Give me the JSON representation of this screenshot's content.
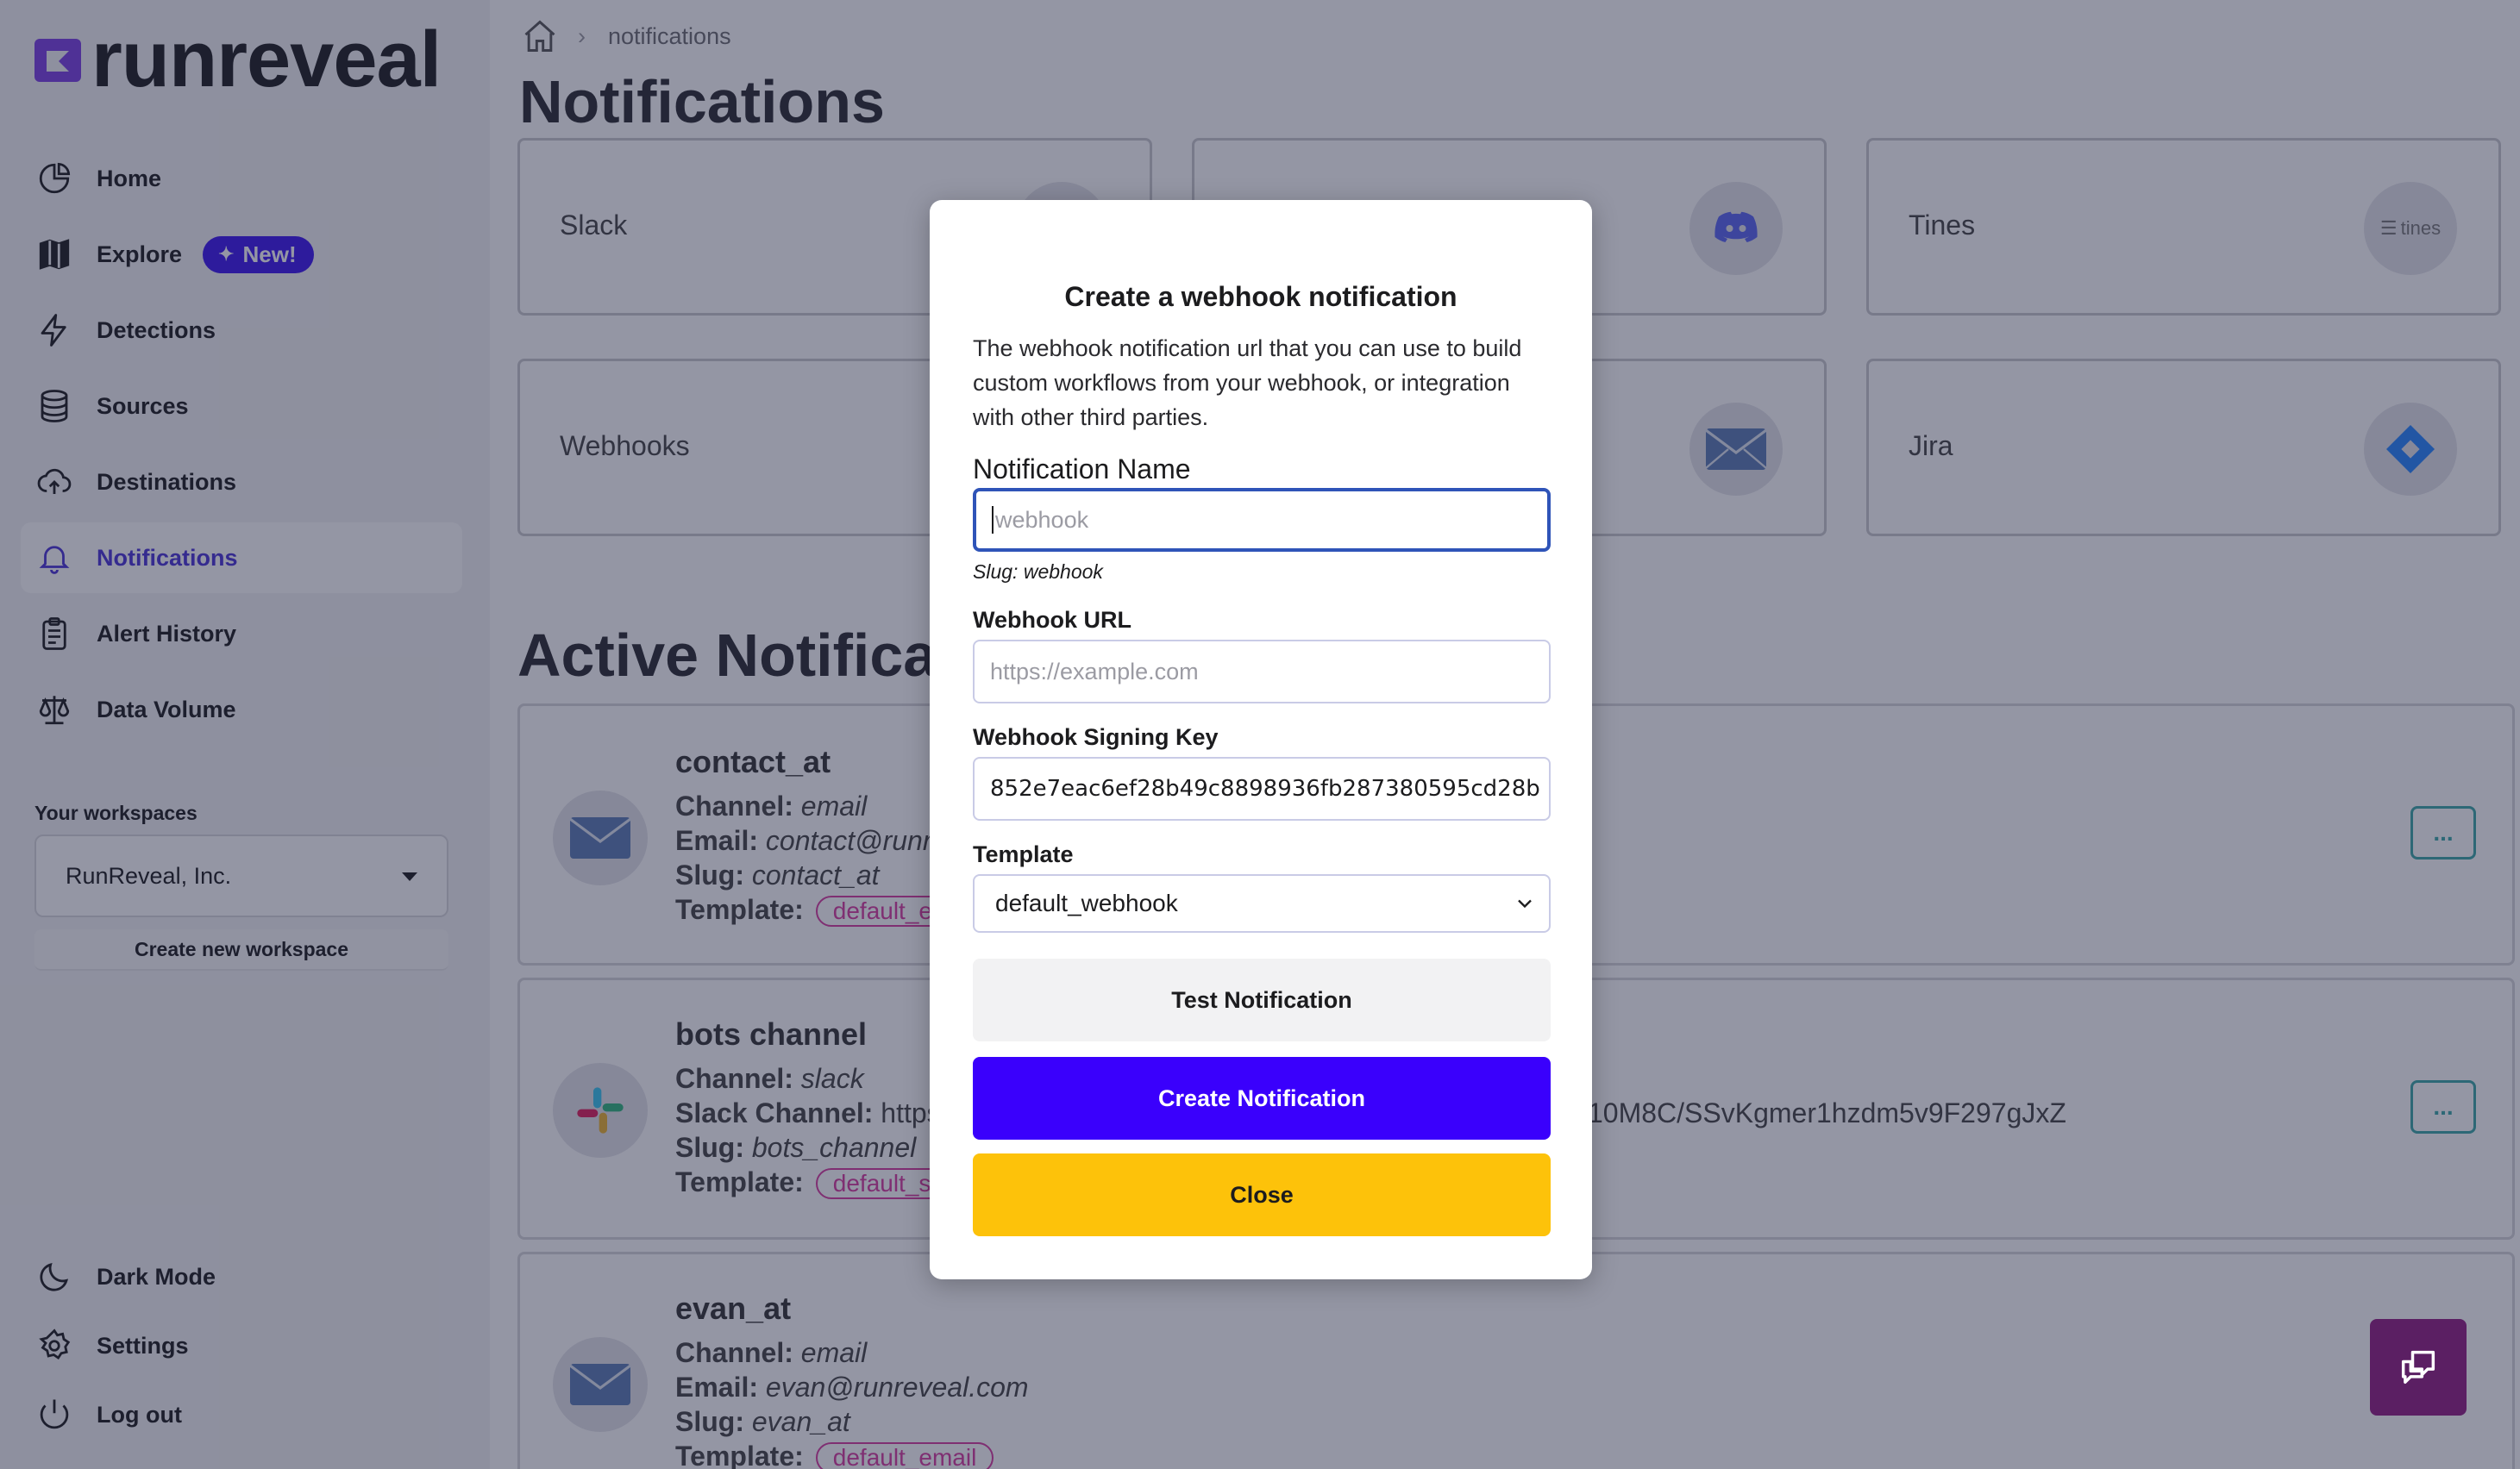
{
  "brand": {
    "name": "runreveal"
  },
  "sidebar": {
    "items": [
      {
        "label": "Home"
      },
      {
        "label": "Explore",
        "badge": "New!"
      },
      {
        "label": "Detections"
      },
      {
        "label": "Sources"
      },
      {
        "label": "Destinations"
      },
      {
        "label": "Notifications"
      },
      {
        "label": "Alert History"
      },
      {
        "label": "Data Volume"
      }
    ],
    "workspaces_title": "Your workspaces",
    "workspace_selected": "RunReveal, Inc.",
    "create_workspace": "Create new workspace",
    "bottom": [
      {
        "label": "Dark Mode"
      },
      {
        "label": "Settings"
      },
      {
        "label": "Log out"
      }
    ]
  },
  "breadcrumb": {
    "current": "notifications"
  },
  "page": {
    "title": "Notifications",
    "integrations": [
      {
        "label": "Slack"
      },
      {
        "label": "Discord"
      },
      {
        "label": "Tines",
        "badge_text": "tines"
      },
      {
        "label": "Webhooks"
      },
      {
        "label": "Email"
      },
      {
        "label": "Jira"
      }
    ],
    "active_title": "Active Notifica",
    "active": [
      {
        "name": "contact_at",
        "channel_label": "Channel:",
        "channel": "email",
        "detail_label": "Email:",
        "detail": "contact@runr",
        "slug_label": "Slug:",
        "slug": "contact_at",
        "template_label": "Template:",
        "template": "default_e"
      },
      {
        "name": "bots channel",
        "channel_label": "Channel:",
        "channel": "slack",
        "detail_label": "Slack Channel:",
        "detail": "https",
        "detail_tail": "10M8C/SSvKgmer1hzdm5v9F297gJxZ",
        "slug_label": "Slug:",
        "slug": "bots_channel",
        "template_label": "Template:",
        "template": "default_s"
      },
      {
        "name": "evan_at",
        "channel_label": "Channel:",
        "channel": "email",
        "detail_label": "Email:",
        "detail": "evan@runreveal.com",
        "slug_label": "Slug:",
        "slug": "evan_at",
        "template_label": "Template:",
        "template": "default_email"
      }
    ],
    "row_menu": "..."
  },
  "modal": {
    "title": "Create a webhook notification",
    "description": "The webhook notification url that you can use to build custom workflows from your webhook, or integration with other third parties.",
    "name_label": "Notification Name",
    "name_placeholder": "webhook",
    "slug_prefix": "Slug:",
    "slug_value": "webhook",
    "url_label": "Webhook URL",
    "url_placeholder": "https://example.com",
    "key_label": "Webhook Signing Key",
    "key_value": "852e7eac6ef28b49c8898936fb287380595cd28b",
    "template_label": "Template",
    "template_value": "default_webhook",
    "test_button": "Test Notification",
    "create_button": "Create Notification",
    "close_button": "Close"
  },
  "colors": {
    "accent": "#3a00fc",
    "active_nav": "#4a32d6",
    "close_button": "#fdc20a",
    "chat_widget": "#5b1f63"
  }
}
